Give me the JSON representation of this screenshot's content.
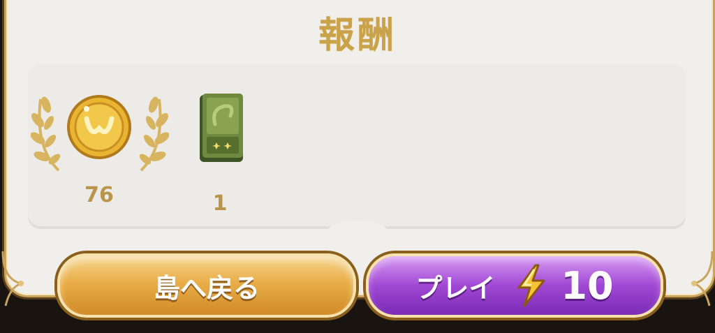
{
  "screen": {
    "title": "報酬"
  },
  "rewards": [
    {
      "item": "coin-icon",
      "count": "76"
    },
    {
      "item": "card-pack-icon",
      "count": "1"
    }
  ],
  "buttons": {
    "back_to_island": "島へ戻る",
    "play_label": "プレイ",
    "play_cost": "10"
  },
  "colors": {
    "gold_text": "#c9a24a",
    "play_button": "#a048d4",
    "island_button": "#e9ae48"
  }
}
